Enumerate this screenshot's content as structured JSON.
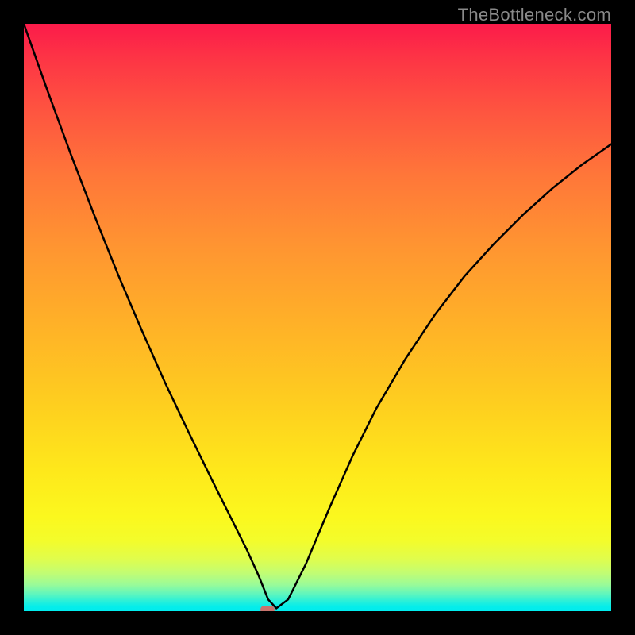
{
  "watermark": "TheBottleneck.com",
  "chart_data": {
    "type": "line",
    "title": "",
    "xlabel": "",
    "ylabel": "",
    "xlim": [
      0,
      1
    ],
    "ylim": [
      0,
      1
    ],
    "series": [
      {
        "name": "curve",
        "x": [
          0.0,
          0.04,
          0.08,
          0.12,
          0.16,
          0.2,
          0.24,
          0.28,
          0.32,
          0.35,
          0.38,
          0.4,
          0.416,
          0.43,
          0.45,
          0.48,
          0.52,
          0.56,
          0.6,
          0.65,
          0.7,
          0.75,
          0.8,
          0.85,
          0.9,
          0.95,
          1.0
        ],
        "y": [
          1.0,
          0.887,
          0.778,
          0.674,
          0.574,
          0.48,
          0.39,
          0.306,
          0.224,
          0.164,
          0.104,
          0.06,
          0.02,
          0.005,
          0.02,
          0.08,
          0.175,
          0.265,
          0.345,
          0.43,
          0.505,
          0.57,
          0.625,
          0.675,
          0.72,
          0.76,
          0.795
        ]
      }
    ],
    "marker": {
      "x": 0.415,
      "y": 0.003
    },
    "background_gradient": {
      "type": "vertical",
      "stops": [
        {
          "pos": 0.0,
          "color": "#fc1b4a"
        },
        {
          "pos": 0.25,
          "color": "#ff7a38"
        },
        {
          "pos": 0.55,
          "color": "#ffc022"
        },
        {
          "pos": 0.78,
          "color": "#fee81b"
        },
        {
          "pos": 0.92,
          "color": "#c8fd6e"
        },
        {
          "pos": 1.0,
          "color": "#00ecee"
        }
      ]
    }
  }
}
